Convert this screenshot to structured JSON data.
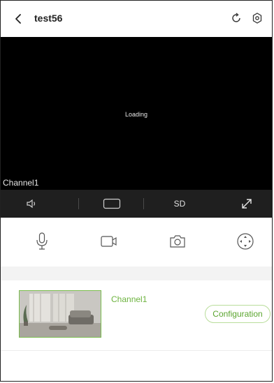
{
  "header": {
    "title": "test56",
    "icons": [
      "back-arrow-icon",
      "refresh-icon",
      "settings-icon"
    ]
  },
  "video": {
    "status": "Loading",
    "channel_label": "Channel1"
  },
  "control_bar": {
    "sd_label": "SD",
    "icons": [
      "speaker-icon",
      "screen-ratio-icon",
      "fullscreen-icon"
    ]
  },
  "actions": {
    "icons": [
      "microphone-icon",
      "record-icon",
      "camera-icon",
      "ptz-icon"
    ]
  },
  "channel_card": {
    "name": "Channel1",
    "config_label": "Configuration"
  },
  "colors": {
    "accent": "#6db33f",
    "video_bg": "#000000",
    "control_bg": "#1f1f1f"
  }
}
